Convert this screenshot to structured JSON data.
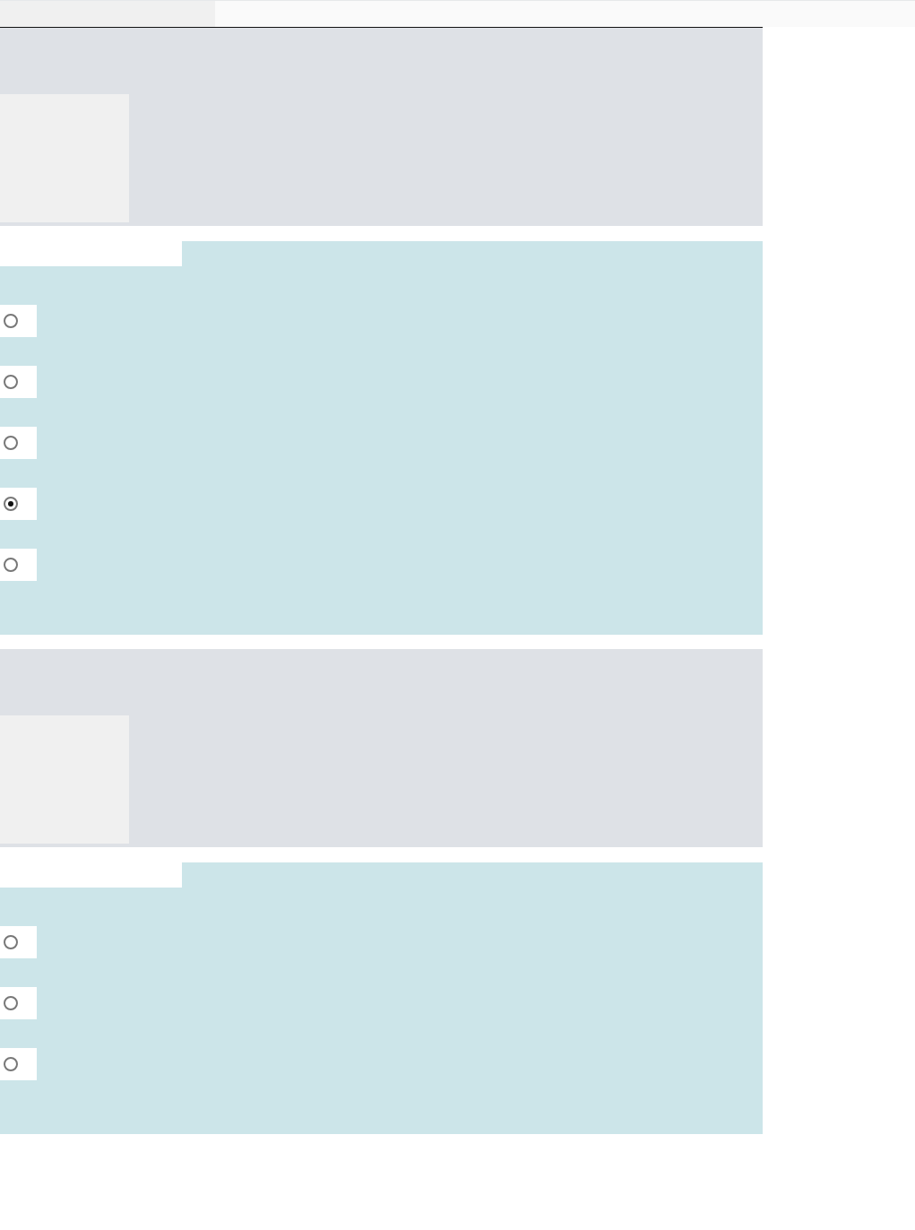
{
  "top_bar": {
    "tabs": [
      {
        "selected": true
      },
      {
        "selected": false
      }
    ]
  },
  "sections": [
    {
      "kind": "info"
    },
    {
      "kind": "question",
      "options": [
        {
          "selected": false
        },
        {
          "selected": false
        },
        {
          "selected": false
        },
        {
          "selected": true
        },
        {
          "selected": false
        }
      ]
    },
    {
      "kind": "info"
    },
    {
      "kind": "question",
      "options": [
        {
          "selected": false
        },
        {
          "selected": false
        },
        {
          "selected": false
        }
      ]
    }
  ]
}
